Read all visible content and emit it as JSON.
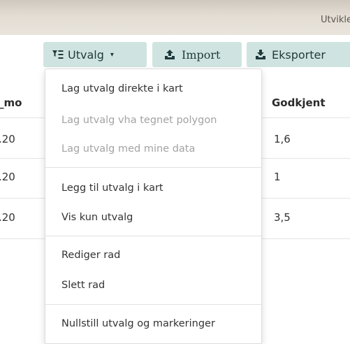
{
  "header": {
    "label": "Utvikle"
  },
  "toolbar": {
    "utvalg_label": "Utvalg",
    "utvalg_caret": "▾",
    "import_label": "Import",
    "export_label": "Eksporter"
  },
  "table": {
    "columns": [
      "_mo",
      "Godkjent"
    ],
    "rows": [
      {
        "left": ".20",
        "godkjent": "1,6"
      },
      {
        "left": ".20",
        "godkjent": "1"
      },
      {
        "left": ".20",
        "godkjent": "3,5"
      }
    ]
  },
  "menu": {
    "items": [
      {
        "label": "Lag utvalg direkte i kart",
        "enabled": true
      },
      {
        "label": "Lag utvalg vha tegnet polygon",
        "enabled": false
      },
      {
        "label": "Lag utvalg med mine data",
        "enabled": false
      },
      {
        "label": "Legg til utvalg i kart",
        "enabled": true
      },
      {
        "label": "Vis kun utvalg",
        "enabled": true
      },
      {
        "label": "Rediger rad",
        "enabled": true
      },
      {
        "label": "Slett rad",
        "enabled": true
      },
      {
        "label": "Nullstill utvalg og markeringer",
        "enabled": true
      }
    ]
  },
  "colors": {
    "button_bg": "#cfe4e0",
    "button_text": "#1f3a3d",
    "disabled_text": "#a3a3a3"
  },
  "icons": {
    "utvalg": "filter-icon",
    "import": "upload-icon",
    "export": "download-icon"
  }
}
